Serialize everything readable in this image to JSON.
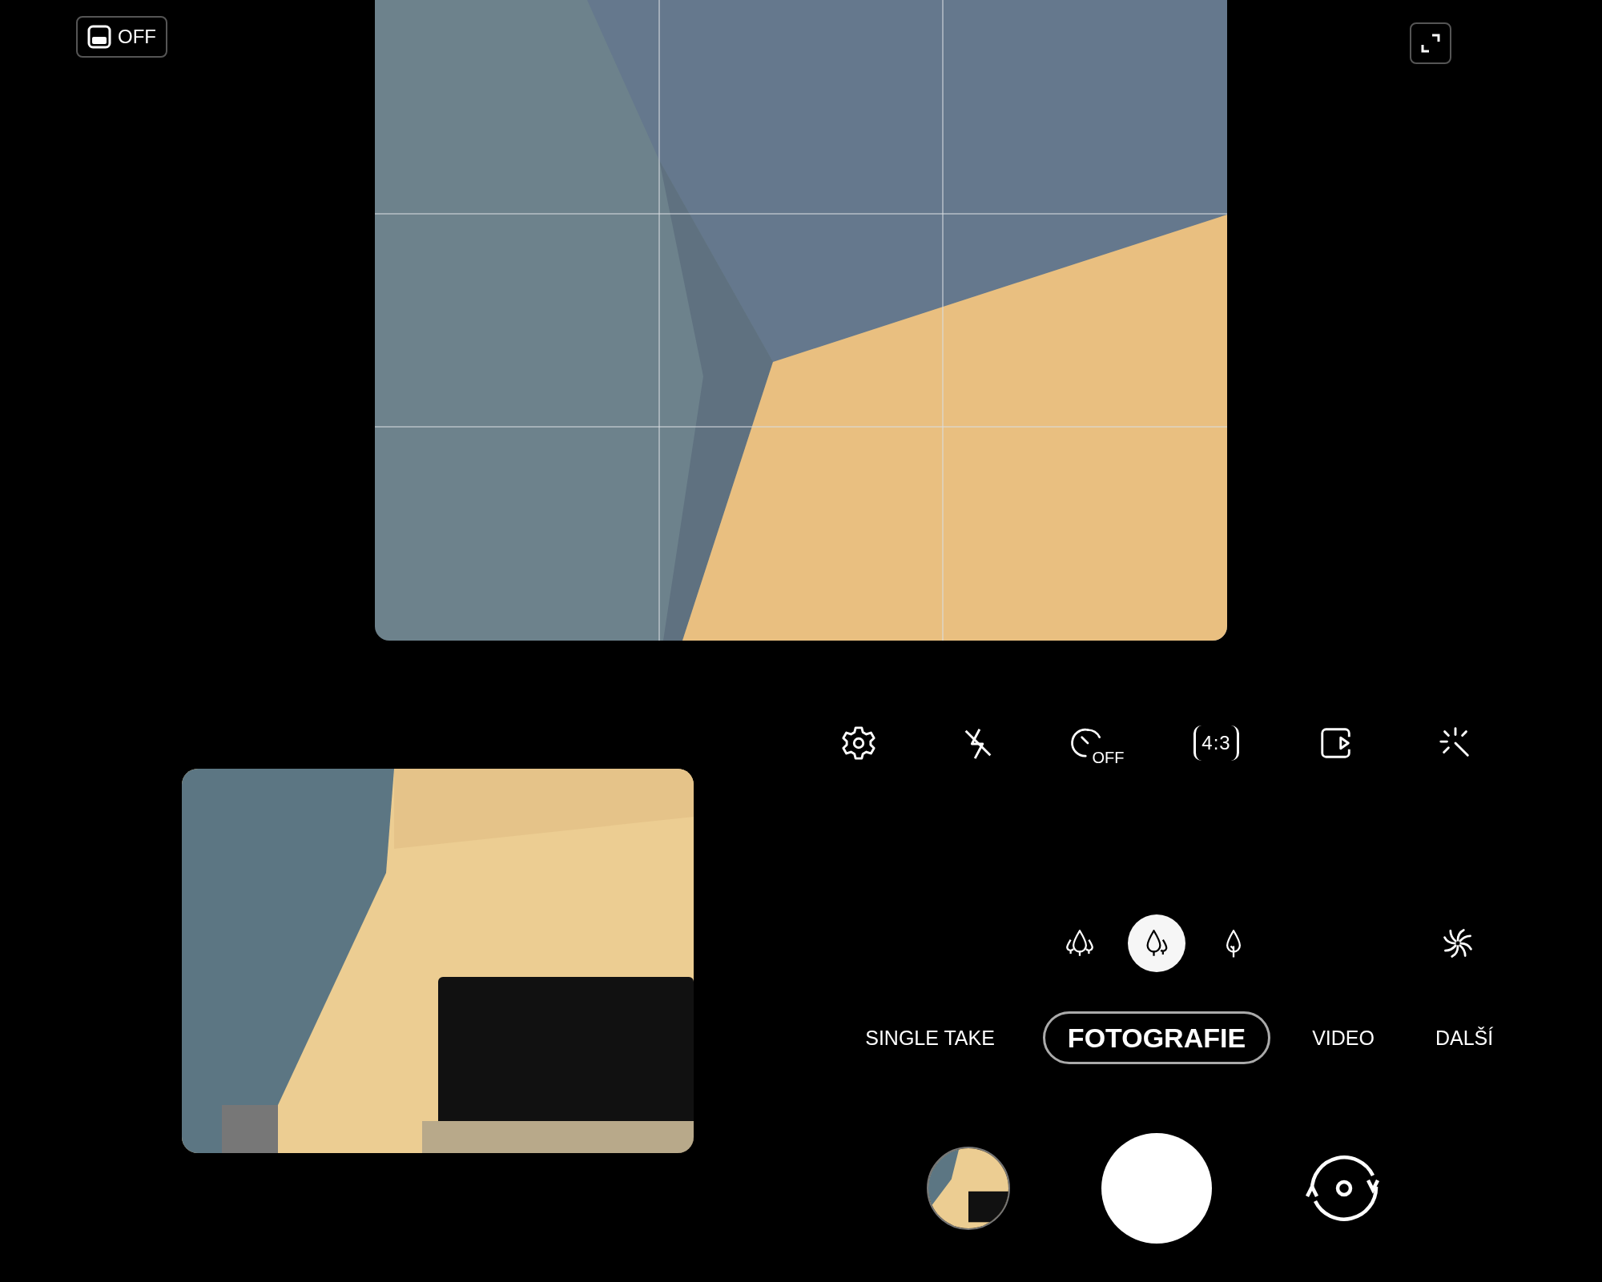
{
  "top_bar": {
    "toggle": {
      "label": "OFF"
    }
  },
  "quick_settings": [
    {
      "kind": "settings"
    },
    {
      "kind": "flash"
    },
    {
      "kind": "timer",
      "label": "OFF"
    },
    {
      "kind": "ratio",
      "label": "4:3"
    },
    {
      "kind": "motion"
    },
    {
      "kind": "filters"
    }
  ],
  "zoom_options": [
    {
      "kind": "ultra_wide",
      "selected": false
    },
    {
      "kind": "wide",
      "selected": true
    },
    {
      "kind": "tele",
      "selected": false
    }
  ],
  "modes": [
    {
      "label": "SINGLE TAKE",
      "selected": false
    },
    {
      "label": "FOTOGRAFIE",
      "selected": true
    },
    {
      "label": "VIDEO",
      "selected": false
    },
    {
      "label": "DALŠÍ",
      "selected": false
    }
  ]
}
